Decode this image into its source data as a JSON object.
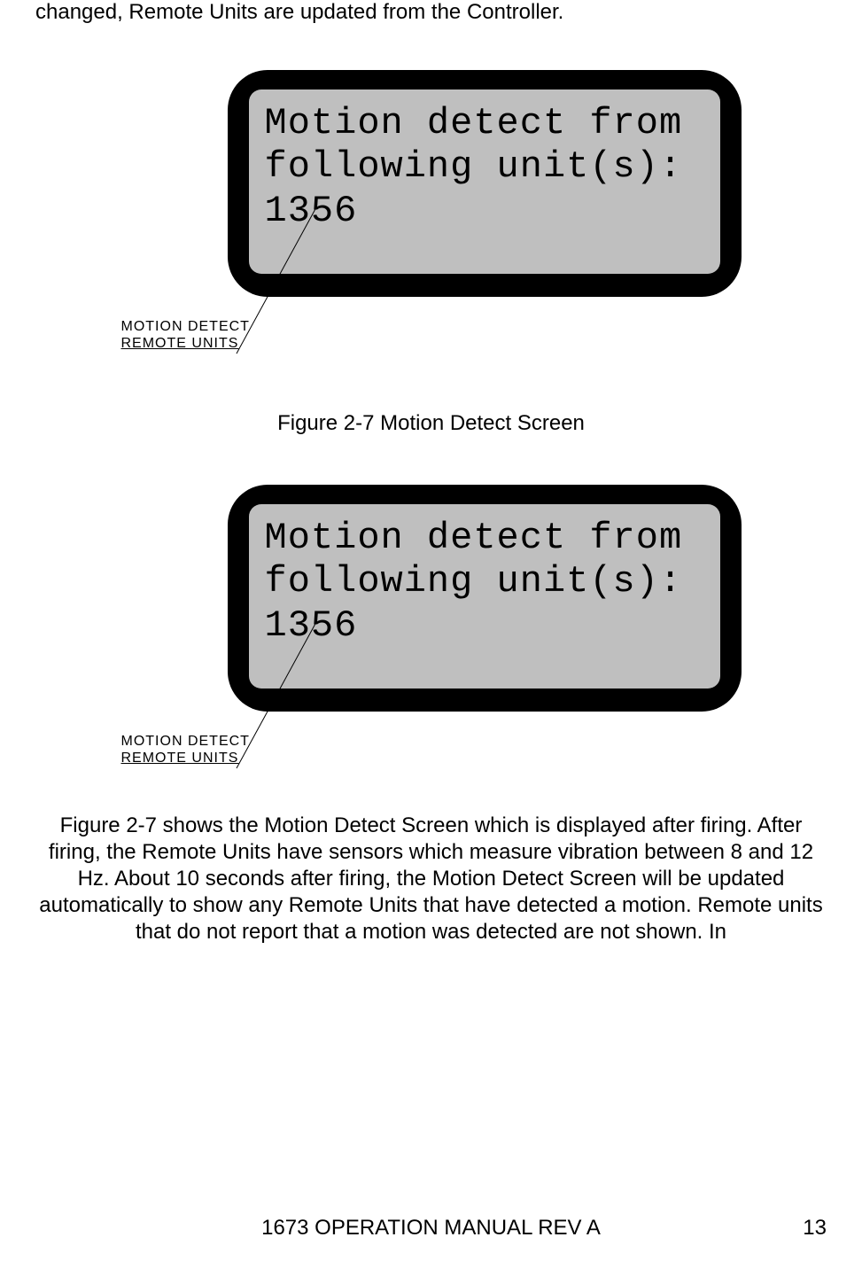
{
  "top_fragment": "changed, Remote Units are updated from the Controller.",
  "figure1": {
    "lcd_line1": "Motion detect from",
    "lcd_line2": "following unit(s):",
    "lcd_line3": "1356",
    "annotation_line1": "MOTION DETECT",
    "annotation_line2": "REMOTE UNITS",
    "caption": "Figure 2-7 Motion Detect Screen"
  },
  "figure2": {
    "lcd_line1": "Motion detect from",
    "lcd_line2": "following unit(s):",
    "lcd_line3": "1356",
    "annotation_line1": "MOTION DETECT",
    "annotation_line2": "REMOTE UNITS"
  },
  "body_paragraph": "Figure 2-7 shows the Motion Detect Screen which is displayed after firing. After firing, the Remote Units have sensors which measure vibration between 8 and 12 Hz. About 10 seconds after firing, the Motion Detect Screen will be updated automatically to show any Remote Units that have detected a motion. Remote units that do not report that a motion was detected are not shown. In",
  "footer": {
    "center": "1673 OPERATION MANUAL REV A",
    "page_number": "13"
  }
}
